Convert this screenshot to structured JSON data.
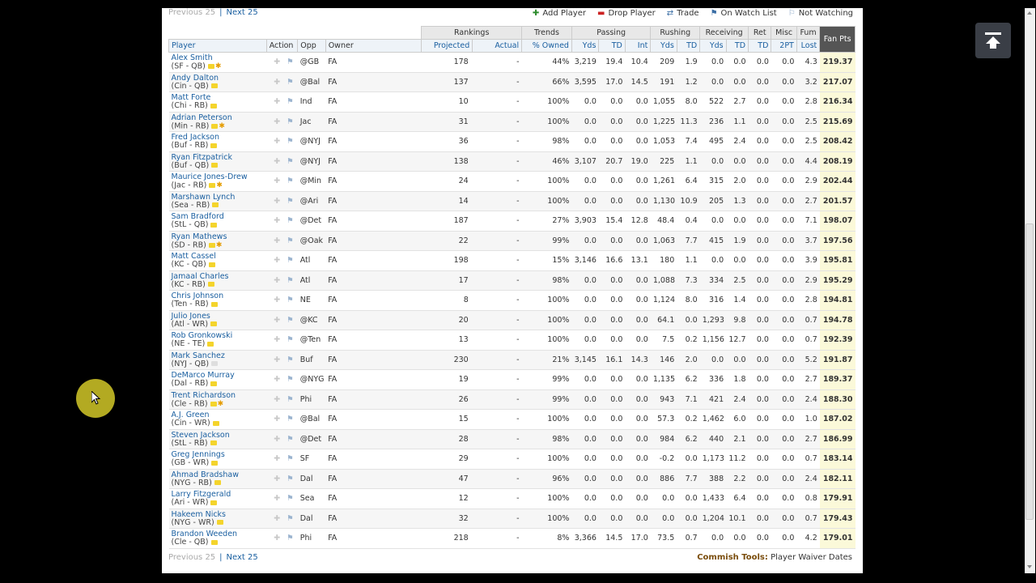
{
  "pager": {
    "prev": "Previous 25",
    "next": "Next 25"
  },
  "actions": [
    {
      "icon": "plus-icon",
      "label": "Add Player",
      "color": "#2a8a2a"
    },
    {
      "icon": "minus-icon",
      "label": "Drop Player",
      "color": "#cc2222"
    },
    {
      "icon": "trade-icon",
      "label": "Trade",
      "color": "#3a6ea5"
    },
    {
      "icon": "flag-icon",
      "label": "On Watch List",
      "color": "#3a6ea5"
    },
    {
      "icon": "flag-outline-icon",
      "label": "Not Watching",
      "color": "#8aa8c8"
    }
  ],
  "groups": [
    "Rankings",
    "Trends",
    "Passing",
    "Rushing",
    "Receiving",
    "Ret",
    "Misc",
    "Fum"
  ],
  "headers": {
    "player": "Player",
    "action": "Action",
    "opp": "Opp",
    "owner": "Owner",
    "projected": "Projected",
    "actual": "Actual",
    "owned": "% Owned",
    "pass_yds": "Yds",
    "pass_td": "TD",
    "pass_int": "Int",
    "rush_yds": "Yds",
    "rush_td": "TD",
    "rec_yds": "Yds",
    "rec_td": "TD",
    "ret_td": "TD",
    "misc_2pt": "2PT",
    "fum_lost": "Lost",
    "fan_pts": "Fan Pts"
  },
  "rows": [
    [
      "Alex Smith",
      "(SF - QB)",
      "@GB",
      "FA",
      "178",
      "-",
      "44%",
      "3,219",
      "19.4",
      "10.4",
      "209",
      "1.9",
      "0.0",
      "0.0",
      "0.0",
      "0.0",
      "4.3",
      "219.37",
      "star"
    ],
    [
      "Andy Dalton",
      "(Cin - QB)",
      "@Bal",
      "FA",
      "137",
      "-",
      "66%",
      "3,595",
      "17.0",
      "14.5",
      "191",
      "1.2",
      "0.0",
      "0.0",
      "0.0",
      "0.0",
      "3.2",
      "217.07",
      "note"
    ],
    [
      "Matt Forte",
      "(Chi - RB)",
      "Ind",
      "FA",
      "10",
      "-",
      "100%",
      "0.0",
      "0.0",
      "0.0",
      "1,055",
      "8.0",
      "522",
      "2.7",
      "0.0",
      "0.0",
      "2.8",
      "216.34",
      "note"
    ],
    [
      "Adrian Peterson",
      "(Min - RB)",
      "Jac",
      "FA",
      "31",
      "-",
      "100%",
      "0.0",
      "0.0",
      "0.0",
      "1,225",
      "11.3",
      "236",
      "1.1",
      "0.0",
      "0.0",
      "2.5",
      "215.69",
      "star"
    ],
    [
      "Fred Jackson",
      "(Buf - RB)",
      "@NYJ",
      "FA",
      "36",
      "-",
      "98%",
      "0.0",
      "0.0",
      "0.0",
      "1,053",
      "7.4",
      "495",
      "2.4",
      "0.0",
      "0.0",
      "2.5",
      "208.42",
      "note"
    ],
    [
      "Ryan Fitzpatrick",
      "(Buf - QB)",
      "@NYJ",
      "FA",
      "138",
      "-",
      "46%",
      "3,107",
      "20.7",
      "19.0",
      "225",
      "1.1",
      "0.0",
      "0.0",
      "0.0",
      "0.0",
      "4.4",
      "208.19",
      "note"
    ],
    [
      "Maurice Jones-Drew",
      "(Jac - RB)",
      "@Min",
      "FA",
      "24",
      "-",
      "100%",
      "0.0",
      "0.0",
      "0.0",
      "1,261",
      "6.4",
      "315",
      "2.0",
      "0.0",
      "0.0",
      "2.9",
      "202.44",
      "star"
    ],
    [
      "Marshawn Lynch",
      "(Sea - RB)",
      "@Ari",
      "FA",
      "14",
      "-",
      "100%",
      "0.0",
      "0.0",
      "0.0",
      "1,130",
      "10.9",
      "205",
      "1.3",
      "0.0",
      "0.0",
      "2.7",
      "201.57",
      "note"
    ],
    [
      "Sam Bradford",
      "(StL - QB)",
      "@Det",
      "FA",
      "187",
      "-",
      "27%",
      "3,903",
      "15.4",
      "12.8",
      "48.4",
      "0.4",
      "0.0",
      "0.0",
      "0.0",
      "0.0",
      "7.1",
      "198.07",
      "note"
    ],
    [
      "Ryan Mathews",
      "(SD - RB)",
      "@Oak",
      "FA",
      "22",
      "-",
      "99%",
      "0.0",
      "0.0",
      "0.0",
      "1,063",
      "7.7",
      "415",
      "1.9",
      "0.0",
      "0.0",
      "3.7",
      "197.56",
      "star"
    ],
    [
      "Matt Cassel",
      "(KC - QB)",
      "Atl",
      "FA",
      "198",
      "-",
      "15%",
      "3,146",
      "16.6",
      "13.1",
      "180",
      "1.1",
      "0.0",
      "0.0",
      "0.0",
      "0.0",
      "3.9",
      "195.81",
      "note"
    ],
    [
      "Jamaal Charles",
      "(KC - RB)",
      "Atl",
      "FA",
      "17",
      "-",
      "98%",
      "0.0",
      "0.0",
      "0.0",
      "1,088",
      "7.3",
      "334",
      "2.5",
      "0.0",
      "0.0",
      "2.9",
      "195.29",
      "note"
    ],
    [
      "Chris Johnson",
      "(Ten - RB)",
      "NE",
      "FA",
      "8",
      "-",
      "100%",
      "0.0",
      "0.0",
      "0.0",
      "1,124",
      "8.0",
      "316",
      "1.4",
      "0.0",
      "0.0",
      "2.8",
      "194.81",
      "note"
    ],
    [
      "Julio Jones",
      "(Atl - WR)",
      "@KC",
      "FA",
      "20",
      "-",
      "100%",
      "0.0",
      "0.0",
      "0.0",
      "64.1",
      "0.0",
      "1,293",
      "9.8",
      "0.0",
      "0.0",
      "0.7",
      "194.78",
      "note"
    ],
    [
      "Rob Gronkowski",
      "(NE - TE)",
      "@Ten",
      "FA",
      "13",
      "-",
      "100%",
      "0.0",
      "0.0",
      "0.0",
      "7.5",
      "0.2",
      "1,156",
      "12.7",
      "0.0",
      "0.0",
      "0.7",
      "192.39",
      "note"
    ],
    [
      "Mark Sanchez",
      "(NYJ - QB)",
      "Buf",
      "FA",
      "230",
      "-",
      "21%",
      "3,145",
      "16.1",
      "14.3",
      "146",
      "2.0",
      "0.0",
      "0.0",
      "0.0",
      "0.0",
      "5.2",
      "191.87",
      "grey"
    ],
    [
      "DeMarco Murray",
      "(Dal - RB)",
      "@NYG",
      "FA",
      "19",
      "-",
      "99%",
      "0.0",
      "0.0",
      "0.0",
      "1,135",
      "6.2",
      "336",
      "1.8",
      "0.0",
      "0.0",
      "2.7",
      "189.37",
      "note"
    ],
    [
      "Trent Richardson",
      "(Cle - RB)",
      "Phi",
      "FA",
      "26",
      "-",
      "99%",
      "0.0",
      "0.0",
      "0.0",
      "943",
      "7.1",
      "421",
      "2.4",
      "0.0",
      "0.0",
      "2.4",
      "188.30",
      "star"
    ],
    [
      "A.J. Green",
      "(Cin - WR)",
      "@Bal",
      "FA",
      "15",
      "-",
      "100%",
      "0.0",
      "0.0",
      "0.0",
      "57.3",
      "0.2",
      "1,462",
      "6.0",
      "0.0",
      "0.0",
      "1.0",
      "187.02",
      "note"
    ],
    [
      "Steven Jackson",
      "(StL - RB)",
      "@Det",
      "FA",
      "28",
      "-",
      "98%",
      "0.0",
      "0.0",
      "0.0",
      "984",
      "6.2",
      "440",
      "2.1",
      "0.0",
      "0.0",
      "2.7",
      "186.99",
      "note"
    ],
    [
      "Greg Jennings",
      "(GB - WR)",
      "SF",
      "FA",
      "29",
      "-",
      "100%",
      "0.0",
      "0.0",
      "0.0",
      "-0.2",
      "0.0",
      "1,173",
      "11.2",
      "0.0",
      "0.0",
      "0.7",
      "183.14",
      "note"
    ],
    [
      "Ahmad Bradshaw",
      "(NYG - RB)",
      "Dal",
      "FA",
      "47",
      "-",
      "96%",
      "0.0",
      "0.0",
      "0.0",
      "886",
      "7.7",
      "388",
      "2.2",
      "0.0",
      "0.0",
      "2.4",
      "182.11",
      "note"
    ],
    [
      "Larry Fitzgerald",
      "(Ari - WR)",
      "Sea",
      "FA",
      "12",
      "-",
      "100%",
      "0.0",
      "0.0",
      "0.0",
      "0.0",
      "0.0",
      "1,433",
      "6.4",
      "0.0",
      "0.0",
      "0.8",
      "179.91",
      "note"
    ],
    [
      "Hakeem Nicks",
      "(NYG - WR)",
      "Dal",
      "FA",
      "32",
      "-",
      "100%",
      "0.0",
      "0.0",
      "0.0",
      "0.0",
      "0.0",
      "1,204",
      "10.1",
      "0.0",
      "0.0",
      "0.7",
      "179.43",
      "note"
    ],
    [
      "Brandon Weeden",
      "(Cle - QB)",
      "Phi",
      "FA",
      "218",
      "-",
      "8%",
      "3,366",
      "14.5",
      "17.0",
      "73.5",
      "0.7",
      "0.0",
      "0.0",
      "0.0",
      "0.0",
      "4.2",
      "179.01",
      "note"
    ]
  ],
  "commish": {
    "label": "Commish Tools:",
    "link": "Player Waiver Dates"
  }
}
